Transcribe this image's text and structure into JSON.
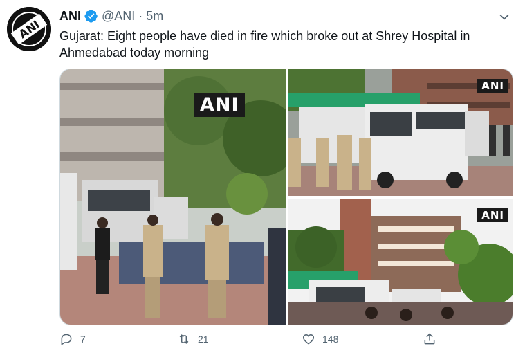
{
  "tweet": {
    "display_name": "ANI",
    "handle": "@ANI",
    "separator": "·",
    "time": "5m",
    "text": "Gujarat: Eight people have died in fire which broke out at Shrey Hospital in Ahmedabad today morning",
    "verified_icon": "verified-badge-icon",
    "menu_icon": "chevron-down-icon",
    "avatar_text": "ANI"
  },
  "media": {
    "photos": [
      {
        "watermark": "ANI"
      },
      {
        "watermark": "ANI"
      },
      {
        "watermark": "ANI"
      }
    ]
  },
  "actions": {
    "reply": {
      "icon": "reply-icon",
      "count": "7"
    },
    "retweet": {
      "icon": "retweet-icon",
      "count": "21"
    },
    "like": {
      "icon": "heart-icon",
      "count": "148"
    },
    "share": {
      "icon": "share-icon",
      "count": ""
    }
  },
  "colors": {
    "text_primary": "#0f1419",
    "text_secondary": "#536471",
    "verified_blue": "#1d9bf0",
    "border": "#cfd9de"
  }
}
